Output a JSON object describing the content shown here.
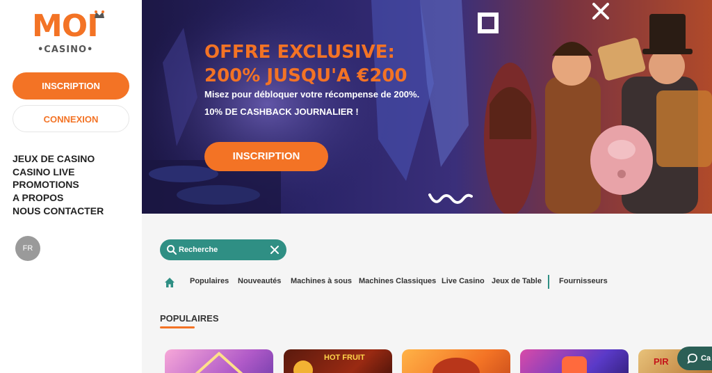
{
  "logo": {
    "main": "MOI",
    "sub": "•CASINO•"
  },
  "sidebar": {
    "register_label": "INSCRIPTION",
    "login_label": "CONNEXION",
    "nav": [
      "JEUX DE CASINO",
      "CASINO LIVE",
      "PROMOTIONS",
      "A PROPOS",
      "NOUS CONTACTER"
    ],
    "language": "FR"
  },
  "hero": {
    "title_line1": "OFFRE EXCLUSIVE:",
    "title_line2": "200% JUSQU'A €200",
    "text_line1": "Misez pour débloquer votre récompense de 200%.",
    "text_line2": "10% DE CASHBACK JOURNALIER !",
    "cta_label": "INSCRIPTION"
  },
  "search": {
    "placeholder": "Recherche"
  },
  "tabs": [
    "Populaires",
    "Nouveautés",
    "Machines à sous",
    "Machines Classiques",
    "Live Casino",
    "Jeux de Table",
    "Fournisseurs"
  ],
  "section": {
    "title": "POPULAIRES"
  },
  "tiles": [
    {
      "label": ""
    },
    {
      "label": "HOT FRUIT"
    },
    {
      "label": ""
    },
    {
      "label": ""
    },
    {
      "label": "PIR"
    }
  ],
  "chat": {
    "label": "Ca"
  },
  "colors": {
    "accent": "#f37325",
    "teal": "#2f8f84"
  }
}
